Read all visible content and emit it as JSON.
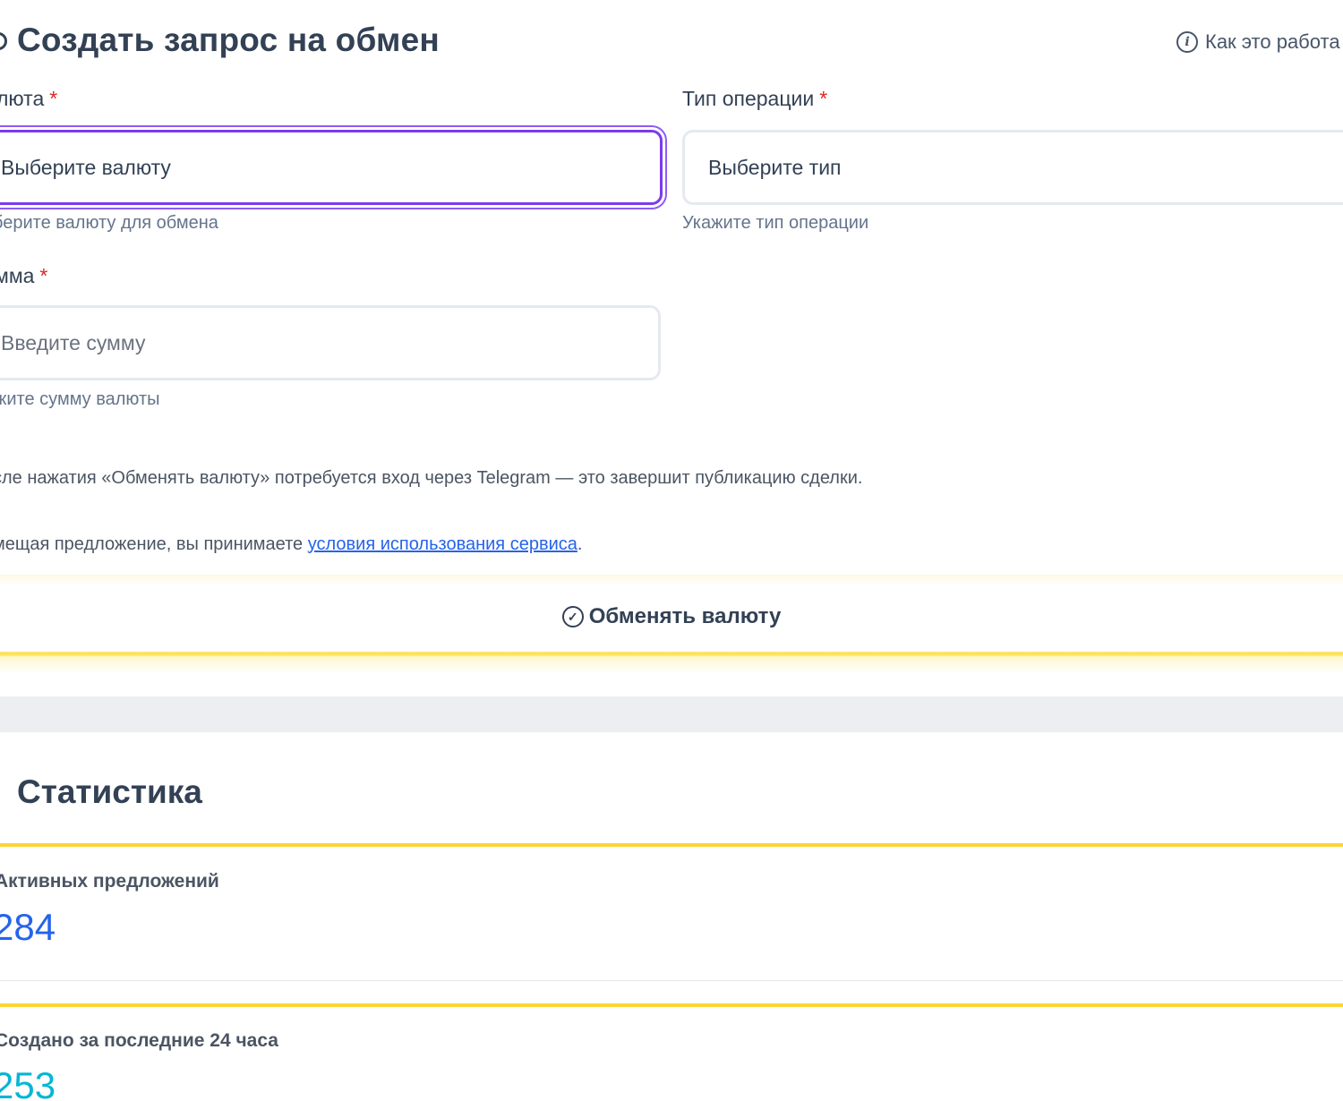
{
  "header": {
    "title": "Создать запрос на обмен",
    "how_it_works": "Как это работа"
  },
  "form": {
    "currency": {
      "label": "люта",
      "required_mark": "*",
      "value": "Выберите валюту",
      "helper": "берите валюту для обмена"
    },
    "operation_type": {
      "label": "Тип операции",
      "required_mark": "*",
      "value": "Выберите тип",
      "helper": "Укажите тип операции"
    },
    "amount": {
      "label": "мма",
      "required_mark": "*",
      "placeholder": "Введите сумму",
      "helper": "жите сумму валюты"
    },
    "notice": "сле нажатия «Обменять валюту» потребуется вход через Telegram — это завершит публикацию сделки.",
    "terms_prefix": "мещая предложение, вы принимаете ",
    "terms_link": "условия использования сервиса",
    "terms_suffix": ".",
    "submit_label": "Обменять валюту"
  },
  "stats": {
    "title": "Статистика",
    "items": [
      {
        "label": "Активных предложений",
        "value": "284",
        "color": "#2563eb"
      },
      {
        "label": "Создано за последние 24 часа",
        "value": "253",
        "color": "#06b6d4"
      }
    ]
  },
  "icons": {
    "info": "info-icon",
    "check": "check-circle-icon"
  },
  "colors": {
    "focus_ring": "#7c3aed",
    "accent_yellow": "#fcd535",
    "link": "#2563eb",
    "required": "#dc2626"
  }
}
